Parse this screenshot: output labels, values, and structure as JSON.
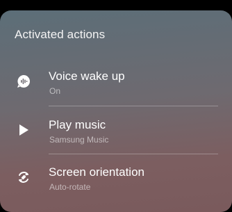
{
  "panel": {
    "title": "Activated actions"
  },
  "actions": [
    {
      "label": "Voice wake up",
      "status": "On",
      "icon": "voice-wake-icon"
    },
    {
      "label": "Play music",
      "status": "Samsung Music",
      "icon": "play-icon"
    },
    {
      "label": "Screen orientation",
      "status": "Auto-rotate",
      "icon": "rotate-icon"
    }
  ]
}
